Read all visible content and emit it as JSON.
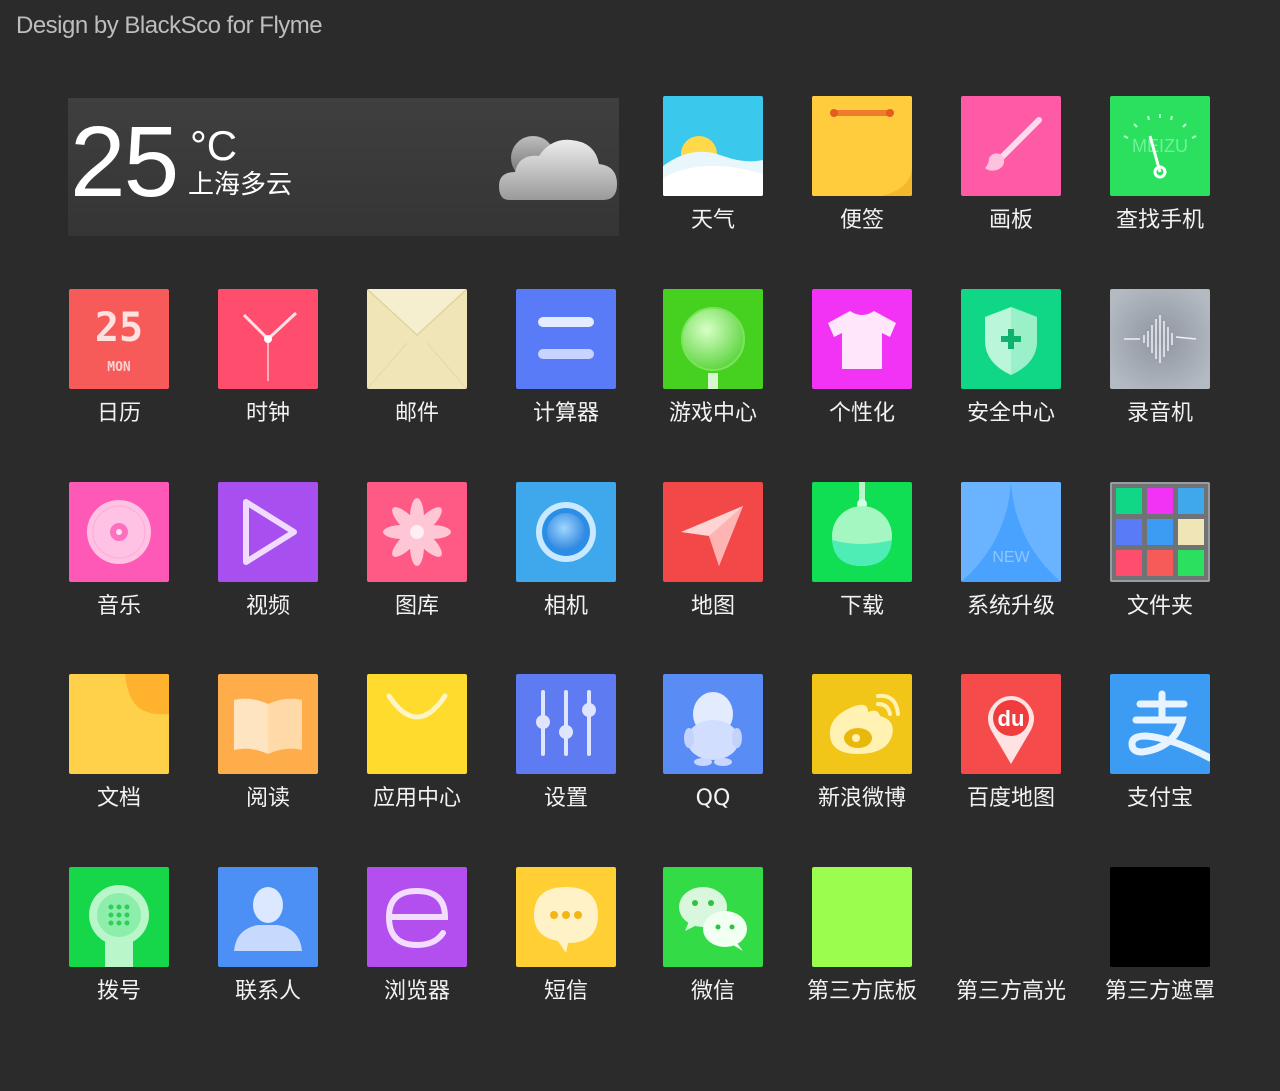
{
  "header": {
    "credit": "Design by BlackSco for Flyme"
  },
  "weather_widget": {
    "temperature": "25",
    "unit": "°C",
    "city_condition": "上海多云",
    "icon": "cloud-icon"
  },
  "apps": [
    {
      "id": "weather",
      "label": "天气",
      "icon": "weather-icon",
      "color": "#3ac8ec"
    },
    {
      "id": "notes",
      "label": "便签",
      "icon": "notes-icon",
      "color": "#ffd04a"
    },
    {
      "id": "paint",
      "label": "画板",
      "icon": "paintbrush-icon",
      "color": "#ff5aa5"
    },
    {
      "id": "findphone",
      "label": "查找手机",
      "icon": "compass-icon",
      "color": "#2be05f",
      "brand": "MEIZU"
    },
    {
      "id": "calendar",
      "label": "日历",
      "icon": "calendar-icon",
      "color": "#f75b59",
      "day": "25",
      "weekday": "MON"
    },
    {
      "id": "clock",
      "label": "时钟",
      "icon": "clock-icon",
      "color": "#ff4d6d"
    },
    {
      "id": "mail",
      "label": "邮件",
      "icon": "envelope-icon",
      "color": "#efe5b7"
    },
    {
      "id": "calculator",
      "label": "计算器",
      "icon": "calculator-icon",
      "color": "#5a7bf8"
    },
    {
      "id": "gamecenter",
      "label": "游戏中心",
      "icon": "joystick-icon",
      "color": "#46d120"
    },
    {
      "id": "theme",
      "label": "个性化",
      "icon": "tshirt-icon",
      "color": "#f233f6"
    },
    {
      "id": "security",
      "label": "安全中心",
      "icon": "shield-icon",
      "color": "#0fd785"
    },
    {
      "id": "recorder",
      "label": "录音机",
      "icon": "waveform-icon",
      "color": "#a8aeb7"
    },
    {
      "id": "music",
      "label": "音乐",
      "icon": "disc-icon",
      "color": "#ff59b7"
    },
    {
      "id": "video",
      "label": "视频",
      "icon": "play-icon",
      "color": "#a84ff0"
    },
    {
      "id": "gallery",
      "label": "图库",
      "icon": "flower-icon",
      "color": "#ff5a86"
    },
    {
      "id": "camera",
      "label": "相机",
      "icon": "lens-icon",
      "color": "#3fa7ec"
    },
    {
      "id": "maps",
      "label": "地图",
      "icon": "navigation-arrow-icon",
      "color": "#f24848"
    },
    {
      "id": "download",
      "label": "下载",
      "icon": "flask-icon",
      "color": "#10de53"
    },
    {
      "id": "update",
      "label": "系统升级",
      "icon": "curtain-icon",
      "color": "#4aa2ff",
      "badge": "NEW"
    },
    {
      "id": "folder",
      "label": "文件夹",
      "icon": "folder-grid-icon",
      "color": "#707376"
    },
    {
      "id": "docs",
      "label": "文档",
      "icon": "document-icon",
      "color": "#ffd14a"
    },
    {
      "id": "reader",
      "label": "阅读",
      "icon": "book-icon",
      "color": "#ffad4a"
    },
    {
      "id": "appcenter",
      "label": "应用中心",
      "icon": "shopping-bag-icon",
      "color": "#ffdb2e"
    },
    {
      "id": "settings",
      "label": "设置",
      "icon": "sliders-icon",
      "color": "#5e7bf2"
    },
    {
      "id": "qq",
      "label": "QQ",
      "icon": "penguin-icon",
      "color": "#5a8cf5"
    },
    {
      "id": "weibo",
      "label": "新浪微博",
      "icon": "weibo-icon",
      "color": "#f2c519"
    },
    {
      "id": "baidumap",
      "label": "百度地图",
      "icon": "map-pin-icon",
      "color": "#f54b4b",
      "mark": "du"
    },
    {
      "id": "alipay",
      "label": "支付宝",
      "icon": "alipay-icon",
      "color": "#3c9cf4"
    },
    {
      "id": "dialer",
      "label": "拨号",
      "icon": "phone-dial-icon",
      "color": "#16d64a"
    },
    {
      "id": "contacts",
      "label": "联系人",
      "icon": "person-icon",
      "color": "#4c8ff5"
    },
    {
      "id": "browser",
      "label": "浏览器",
      "icon": "e-browser-icon",
      "color": "#b34fef"
    },
    {
      "id": "sms",
      "label": "短信",
      "icon": "chat-bubble-icon",
      "color": "#ffcf33"
    },
    {
      "id": "wechat",
      "label": "微信",
      "icon": "wechat-icon",
      "color": "#33db46"
    },
    {
      "id": "thirdparty_base",
      "label": "第三方底板",
      "icon": "base-plate-icon",
      "color": "#9bfd4e"
    },
    {
      "id": "thirdparty_highlight",
      "label": "第三方高光",
      "icon": "highlight-icon",
      "color": "#2b2b2b"
    },
    {
      "id": "thirdparty_mask",
      "label": "第三方遮罩",
      "icon": "mask-icon",
      "color": "#000000"
    }
  ]
}
